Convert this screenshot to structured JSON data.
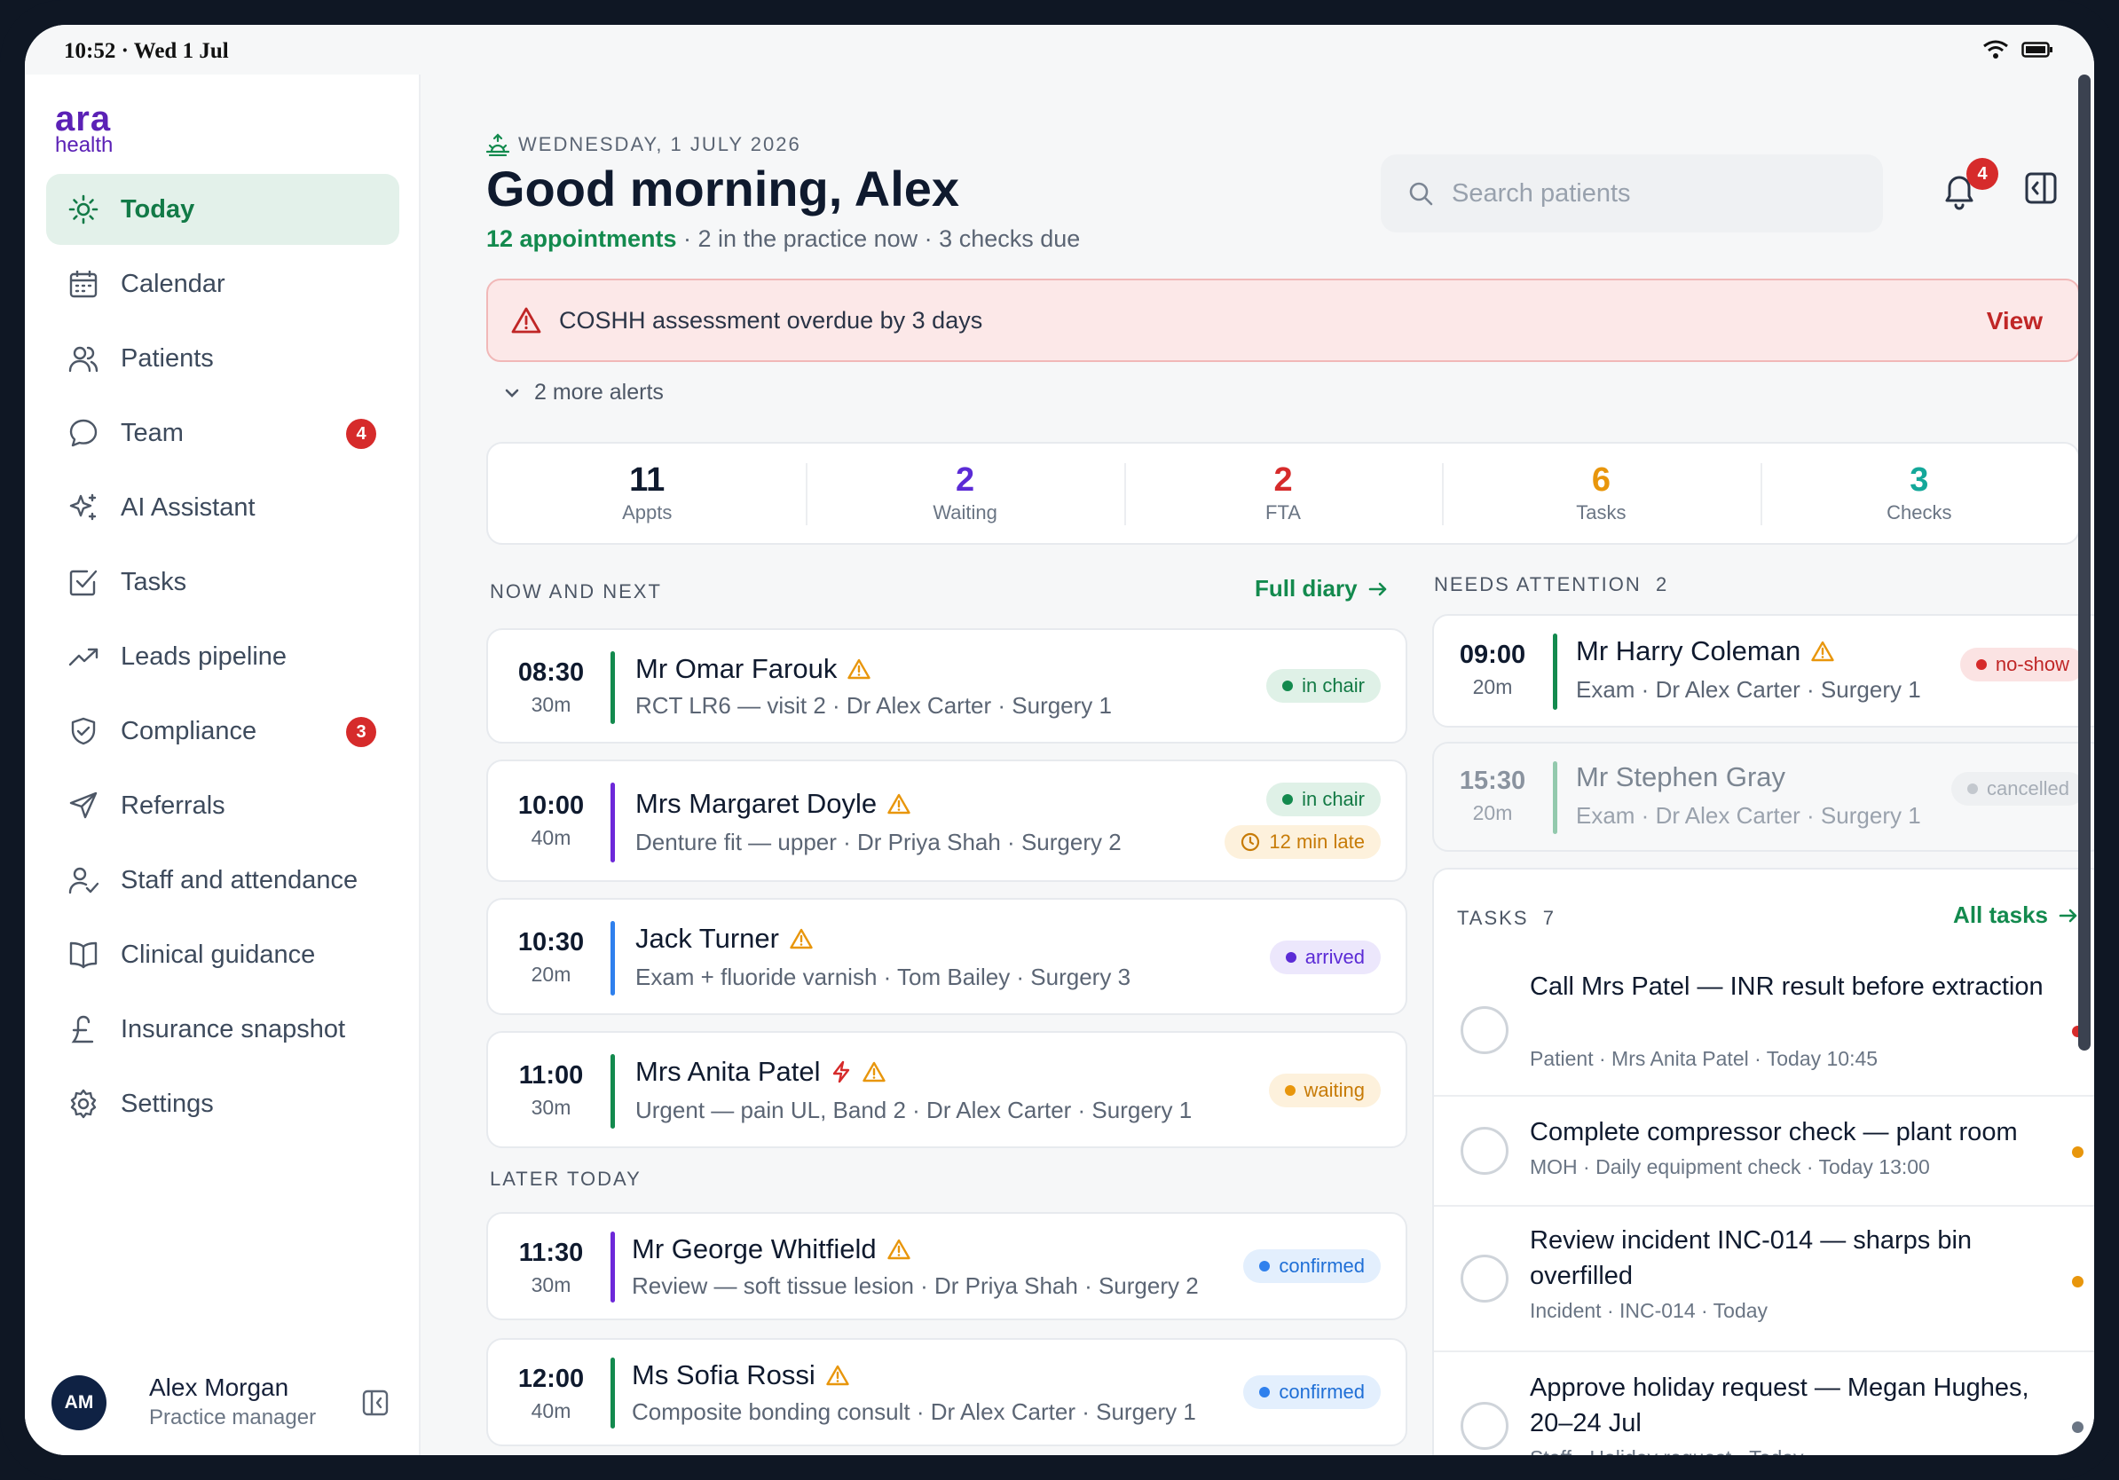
{
  "status": {
    "time": "10:52 · Wed 1 Jul"
  },
  "brand": {
    "line1": "ara",
    "line2": "health"
  },
  "sidebar": {
    "items": [
      {
        "label": "Today",
        "icon": "sun-icon",
        "active": true
      },
      {
        "label": "Calendar",
        "icon": "calendar-icon"
      },
      {
        "label": "Patients",
        "icon": "users-icon"
      },
      {
        "label": "Team",
        "icon": "chat-icon",
        "badge": "4"
      },
      {
        "label": "AI Assistant",
        "icon": "sparkle-icon"
      },
      {
        "label": "Tasks",
        "icon": "checkbox-icon"
      },
      {
        "label": "Leads pipeline",
        "icon": "trend-icon"
      },
      {
        "label": "Compliance",
        "icon": "shield-icon",
        "badge": "3"
      },
      {
        "label": "Referrals",
        "icon": "send-icon"
      },
      {
        "label": "Staff and attendance",
        "icon": "staff-icon"
      },
      {
        "label": "Clinical guidance",
        "icon": "book-icon"
      },
      {
        "label": "Insurance snapshot",
        "icon": "pound-icon"
      },
      {
        "label": "Settings",
        "icon": "gear-icon"
      }
    ]
  },
  "user": {
    "initials": "AM",
    "name": "Alex Morgan",
    "role": "Practice manager"
  },
  "header": {
    "date": "WEDNESDAY, 1 JULY 2026",
    "greeting": "Good morning, Alex",
    "appointments": "12 appointments",
    "summary": " · 2 in the practice now · 3 checks due",
    "search_placeholder": "Search patients",
    "notifications": "4"
  },
  "alert": {
    "text": "COSHH assessment overdue by 3 days",
    "action": "View",
    "more": "2 more alerts"
  },
  "stats": [
    {
      "value": "11",
      "label": "Appts",
      "color": "#0f1a2e"
    },
    {
      "value": "2",
      "label": "Waiting",
      "color": "#5b2bd6"
    },
    {
      "value": "2",
      "label": "FTA",
      "color": "#d62b2b"
    },
    {
      "value": "6",
      "label": "Tasks",
      "color": "#e8960c"
    },
    {
      "value": "3",
      "label": "Checks",
      "color": "#14a89a"
    }
  ],
  "now_next": {
    "heading": "NOW AND NEXT",
    "link": "Full diary",
    "appointments": [
      {
        "time": "08:30",
        "duration": "30m",
        "name": "Mr Omar Farouk",
        "detail": "RCT LR6 — visit 2 · Dr Alex Carter · Surgery 1",
        "status": "in chair",
        "bar": "#138a4e"
      },
      {
        "time": "10:00",
        "duration": "40m",
        "name": "Mrs Margaret Doyle",
        "detail": "Denture fit — upper · Dr Priya Shah · Surgery 2",
        "status": "in chair",
        "late": "12  min late",
        "bar": "#6d28d9"
      },
      {
        "time": "10:30",
        "duration": "20m",
        "name": "Jack Turner",
        "detail": "Exam + fluoride varnish · Tom Bailey · Surgery 3",
        "status": "arrived",
        "bar": "#2f80ed"
      },
      {
        "time": "11:00",
        "duration": "30m",
        "name": "Mrs Anita Patel",
        "detail": "Urgent — pain UL, Band 2 · Dr Alex Carter · Surgery 1",
        "status": "waiting",
        "bar": "#138a4e"
      }
    ]
  },
  "later": {
    "heading": "LATER TODAY",
    "appointments": [
      {
        "time": "11:30",
        "duration": "30m",
        "name": "Mr George Whitfield",
        "detail": "Review — soft tissue lesion · Dr Priya Shah · Surgery 2",
        "status": "confirmed",
        "bar": "#6d28d9"
      },
      {
        "time": "12:00",
        "duration": "40m",
        "name": "Ms Sofia Rossi",
        "detail": "Composite bonding consult · Dr Alex Carter · Surgery 1",
        "status": "confirmed",
        "bar": "#138a4e"
      }
    ]
  },
  "attention": {
    "heading": "NEEDS ATTENTION",
    "count": "2",
    "items": [
      {
        "time": "09:00",
        "duration": "20m",
        "name": "Mr Harry Coleman",
        "detail": "Exam · Dr Alex Carter · Surgery 1",
        "status": "no-show"
      },
      {
        "time": "15:30",
        "duration": "20m",
        "name": "Mr Stephen Gray",
        "detail": "Exam · Dr Alex Carter · Surgery 1",
        "status": "cancelled"
      }
    ]
  },
  "tasks": {
    "heading": "TASKS",
    "count": "7",
    "link": "All tasks",
    "items": [
      {
        "title": "Call Mrs Patel — INR result before extraction",
        "meta": "Patient · Mrs Anita Patel · Today 10:45",
        "priority": "#d62b2b"
      },
      {
        "title": "Complete compressor check — plant room",
        "meta": "MOH · Daily equipment check · Today 13:00",
        "priority": "#e8960c"
      },
      {
        "title": "Review incident INC-014 — sharps bin overfilled",
        "meta": "Incident · INC-014 · Today",
        "priority": "#e8960c"
      },
      {
        "title": "Approve holiday request — Megan Hughes, 20–24 Jul",
        "meta": "Staff · Holiday request · Today",
        "priority": "#6a7584"
      }
    ]
  }
}
